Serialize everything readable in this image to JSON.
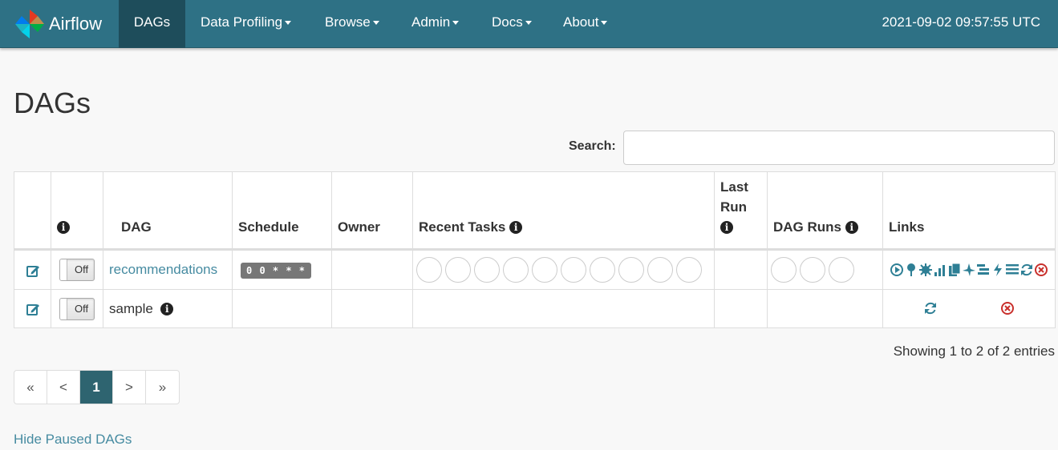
{
  "navbar": {
    "brand": "Airflow",
    "items": [
      {
        "label": "DAGs",
        "active": true,
        "dropdown": false
      },
      {
        "label": "Data Profiling",
        "dropdown": true
      },
      {
        "label": "Browse",
        "dropdown": true
      },
      {
        "label": "Admin",
        "dropdown": true
      },
      {
        "label": "Docs",
        "dropdown": true
      },
      {
        "label": "About",
        "dropdown": true
      }
    ],
    "time": "2021-09-02 09:57:55 UTC",
    "color": "#2e7185"
  },
  "page": {
    "title": "DAGs",
    "search_label": "Search:",
    "search_value": ""
  },
  "table": {
    "headers": {
      "info": "i",
      "dag": "DAG",
      "schedule": "Schedule",
      "owner": "Owner",
      "recent_tasks": "Recent Tasks",
      "last_run_1": "Last",
      "last_run_2": "Run",
      "dag_runs": "DAG Runs",
      "links": "Links"
    },
    "rows": [
      {
        "toggle": "Off",
        "dag": "recommendations",
        "schedule": "0 0 * * *",
        "owner": "",
        "recent_task_circles": 10,
        "last_run": "",
        "dag_run_circles": 3
      },
      {
        "toggle": "Off",
        "dag": "sample",
        "info": "i",
        "schedule": "",
        "owner": "",
        "last_run": ""
      }
    ]
  },
  "footer": {
    "showing": "Showing 1 to 2 of 2 entries",
    "pager": [
      "«",
      "<",
      "1",
      ">",
      "»"
    ],
    "active_page": "1",
    "hide_paused": "Hide Paused DAGs"
  },
  "colors": {
    "link": "#468ba1",
    "icon_teal": "#2e7f95",
    "delete_red": "#c9302c"
  }
}
